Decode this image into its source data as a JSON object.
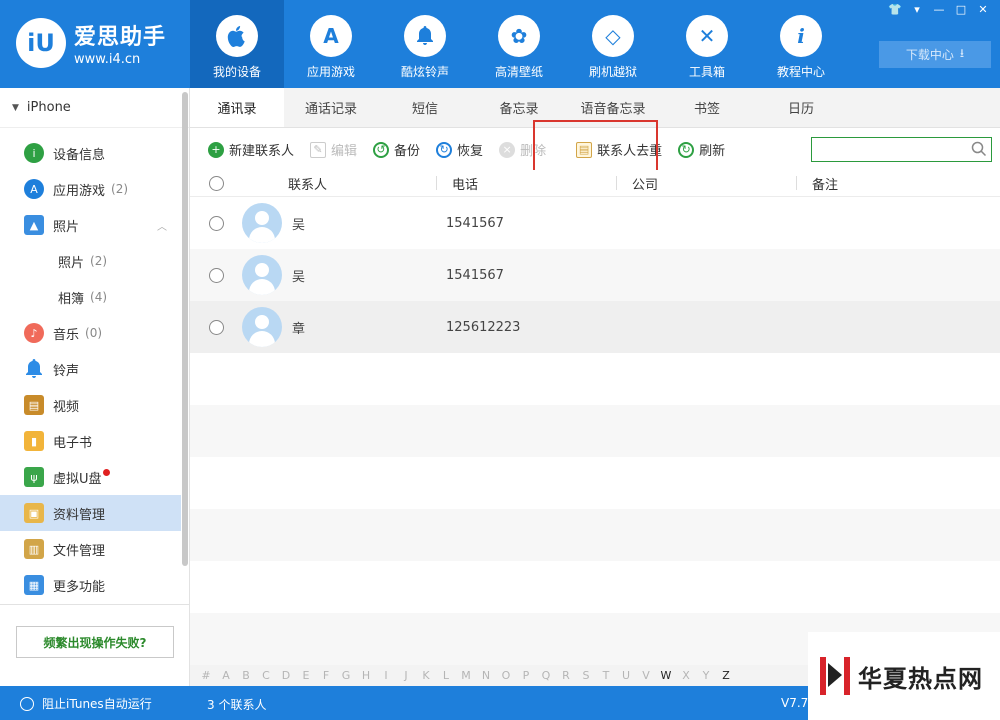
{
  "app": {
    "logo_mark": "iU",
    "title": "爱思助手",
    "url": "www.i4.cn"
  },
  "topnav": [
    {
      "label": "我的设备",
      "icon": "apple-icon",
      "glyph": ""
    },
    {
      "label": "应用游戏",
      "icon": "app-store-icon",
      "glyph": "A"
    },
    {
      "label": "酷炫铃声",
      "icon": "bell-icon",
      "glyph": "🔔"
    },
    {
      "label": "高清壁纸",
      "icon": "flower-icon",
      "glyph": "✿"
    },
    {
      "label": "刷机越狱",
      "icon": "dropbox-icon",
      "glyph": "◇"
    },
    {
      "label": "工具箱",
      "icon": "tools-icon",
      "glyph": "✕"
    },
    {
      "label": "教程中心",
      "icon": "info-icon",
      "glyph": "i"
    }
  ],
  "window_controls": [
    "👕",
    "▾",
    "—",
    "□",
    "✕"
  ],
  "download_center": {
    "label": "下载中心",
    "icon": "download-icon",
    "glyph": "⭳"
  },
  "sidebar": {
    "device": "iPhone",
    "items": [
      {
        "label": "设备信息",
        "count": "",
        "icon": "info-circle-icon",
        "color": "#2ea043",
        "glyph": "i"
      },
      {
        "label": "应用游戏",
        "count": "(2)",
        "icon": "app-store-icon",
        "color": "#1e7fdb",
        "glyph": "A"
      },
      {
        "label": "照片",
        "count": "",
        "icon": "photo-icon",
        "color": "#3a8ee0",
        "glyph": "▲"
      },
      {
        "label": "照片",
        "count": "(2)",
        "icon": "",
        "color": "",
        "glyph": ""
      },
      {
        "label": "相簿",
        "count": "(4)",
        "icon": "",
        "color": "",
        "glyph": ""
      },
      {
        "label": "音乐",
        "count": "(0)",
        "icon": "music-icon",
        "color": "#f06a5a",
        "glyph": "♪"
      },
      {
        "label": "铃声",
        "count": "",
        "icon": "bell-icon",
        "color": "#2d8ce6",
        "glyph": "🔔"
      },
      {
        "label": "视频",
        "count": "",
        "icon": "film-icon",
        "color": "#c88b2a",
        "glyph": "▤"
      },
      {
        "label": "电子书",
        "count": "",
        "icon": "book-icon",
        "color": "#f2b43a",
        "glyph": "▮"
      },
      {
        "label": "虚拟U盘",
        "count": "",
        "icon": "usb-icon",
        "color": "#3aa64a",
        "glyph": "ψ"
      },
      {
        "label": "资料管理",
        "count": "",
        "icon": "contacts-book-icon",
        "color": "#e8b64a",
        "glyph": "▣"
      },
      {
        "label": "文件管理",
        "count": "",
        "icon": "file-icon",
        "color": "#d2a548",
        "glyph": "▥"
      },
      {
        "label": "更多功能",
        "count": "",
        "icon": "grid-icon",
        "color": "#3a8ee0",
        "glyph": "▦"
      }
    ],
    "help_button": "频繁出现操作失败?"
  },
  "tabs": [
    "通讯录",
    "通话记录",
    "短信",
    "备忘录",
    "语音备忘录",
    "书签",
    "日历"
  ],
  "toolbar": {
    "new": "新建联系人",
    "edit": "编辑",
    "backup": "备份",
    "restore": "恢复",
    "delete": "删除",
    "dedupe": "联系人去重",
    "refresh": "刷新"
  },
  "search": {
    "placeholder": ""
  },
  "table": {
    "headers": [
      "联系人",
      "电话",
      "公司",
      "备注"
    ],
    "rows": [
      {
        "name": "吴",
        "phone": "1541567",
        "company": "",
        "note": ""
      },
      {
        "name": "吴",
        "phone": "1541567",
        "company": "",
        "note": ""
      },
      {
        "name": "章",
        "phone": "125612223",
        "company": "",
        "note": ""
      }
    ]
  },
  "alphabet": [
    "#",
    "A",
    "B",
    "C",
    "D",
    "E",
    "F",
    "G",
    "H",
    "I",
    "J",
    "K",
    "L",
    "M",
    "N",
    "O",
    "P",
    "Q",
    "R",
    "S",
    "T",
    "U",
    "V",
    "W",
    "X",
    "Y",
    "Z"
  ],
  "alphabet_active": [
    "W",
    "Z"
  ],
  "status": {
    "itunes": "阻止iTunes自动运行",
    "count": "3 个联系人",
    "version": "V7.7"
  },
  "watermark": "华夏热点网",
  "colors": {
    "brand_blue": "#1e7fdb",
    "highlight_red": "#d9362e",
    "search_border": "#2b9a3d"
  }
}
